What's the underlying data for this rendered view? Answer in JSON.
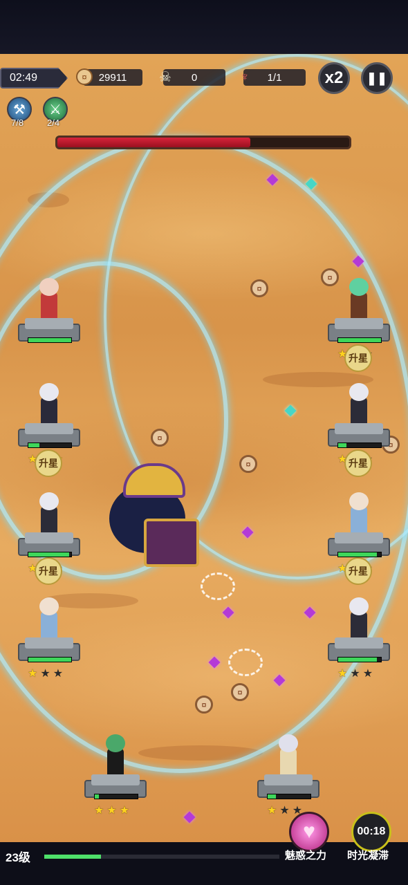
{
  "hud": {
    "timer": "02:49",
    "coins": "29911",
    "kills": "0",
    "wave": "1/1",
    "speed_label": "x2",
    "pause_label": "❚❚"
  },
  "skills": [
    {
      "icon": "hammer-icon",
      "count": "7/8"
    },
    {
      "icon": "sword-icon",
      "count": "2/4"
    }
  ],
  "boss": {
    "hp_fraction": 0.66
  },
  "heroes": {
    "upgrade_label": "升星"
  },
  "bottom": {
    "level": "23级",
    "xp_fraction": 0.24,
    "charm_label": "魅惑之力",
    "freeze_label": "时光凝滞",
    "freeze_timer": "00:18"
  },
  "colors": {
    "hp": "#3ed65a",
    "boss_hp": "#d8243a",
    "star": "#ffd21e"
  }
}
